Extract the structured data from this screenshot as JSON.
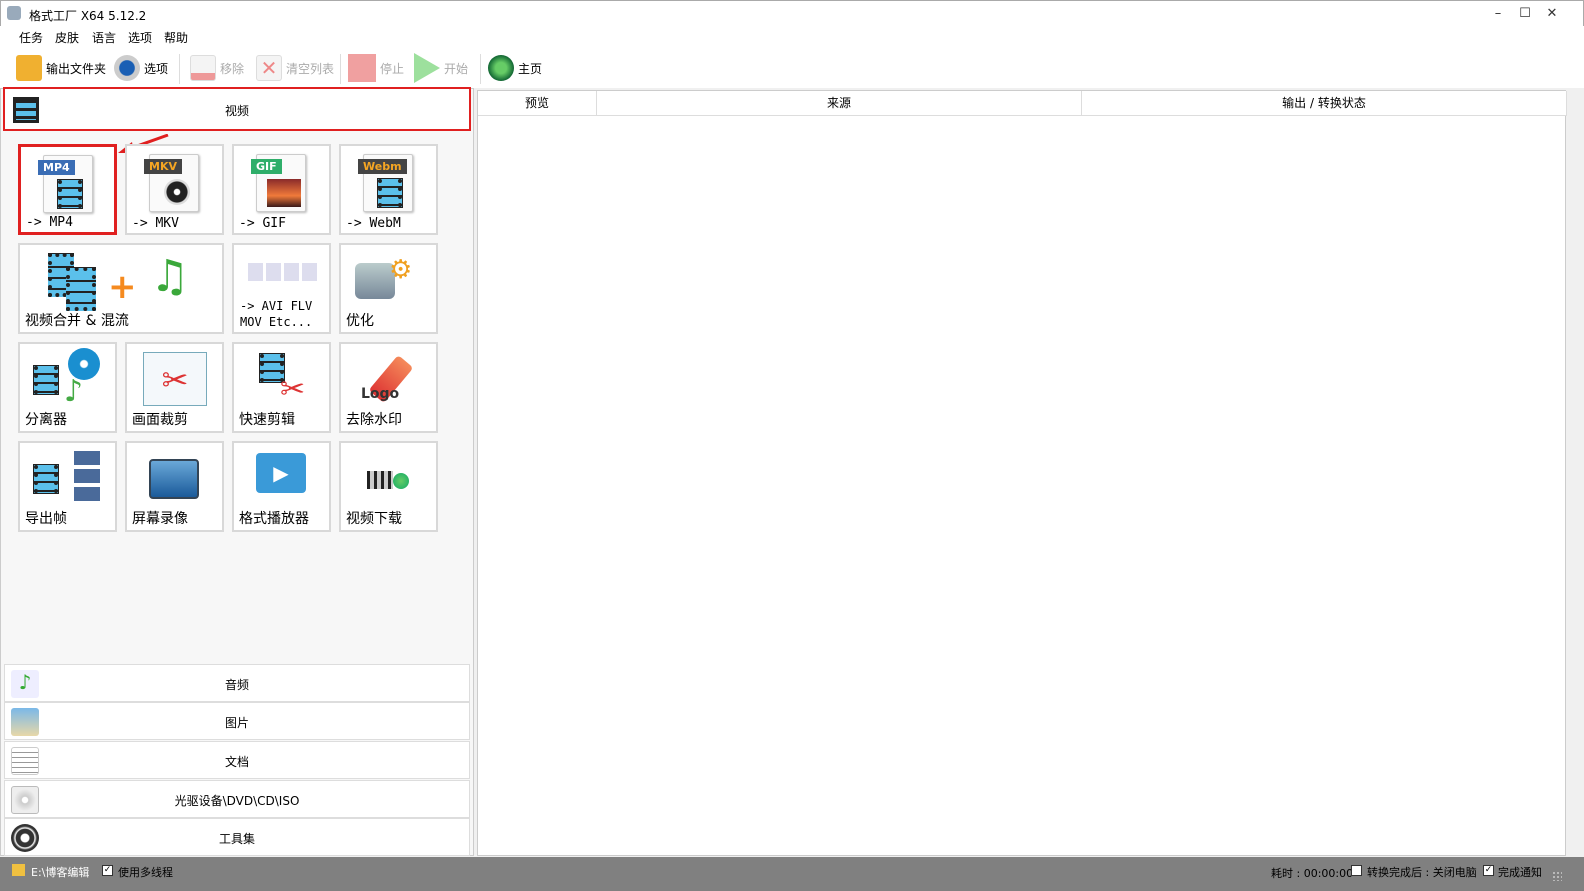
{
  "window": {
    "title": "格式工厂 X64 5.12.2",
    "minimize": "–",
    "maximize": "☐",
    "close": "✕"
  },
  "menu": [
    "任务",
    "皮肤",
    "语言",
    "选项",
    "帮助"
  ],
  "toolbar": {
    "output_folder": "输出文件夹",
    "options": "选项",
    "remove": "移除",
    "clear_list": "清空列表",
    "stop": "停止",
    "start": "开始",
    "home": "主页"
  },
  "video_section": {
    "label": "视频",
    "tiles": [
      {
        "badge": "MP4",
        "label": "-> MP4",
        "color": "#3a6db5"
      },
      {
        "badge": "MKV",
        "label": "-> MKV",
        "color": "#444444"
      },
      {
        "badge": "GIF",
        "label": "-> GIF",
        "color": "#2fae6a"
      },
      {
        "badge": "Webm",
        "label": "-> WebM",
        "color": "#444444"
      },
      {
        "label": "视频合并 & 混流"
      },
      {
        "label_line1": "-> AVI FLV",
        "label_line2": "MOV Etc..."
      },
      {
        "label": "优化"
      },
      {
        "label": "分离器"
      },
      {
        "label": "画面裁剪"
      },
      {
        "label": "快速剪辑"
      },
      {
        "label": "去除水印",
        "logo_text": "Logo"
      },
      {
        "label": "导出帧"
      },
      {
        "label": "屏幕录像"
      },
      {
        "label": "格式播放器"
      },
      {
        "label": "视频下载"
      }
    ]
  },
  "categories": [
    "音频",
    "图片",
    "文档",
    "光驱设备\\DVD\\CD\\ISO",
    "工具集"
  ],
  "table": {
    "columns": [
      "预览",
      "来源",
      "输出 / 转换状态"
    ]
  },
  "status": {
    "path": "E:\\博客编辑",
    "multithread": "使用多线程",
    "multithread_checked": true,
    "elapsed": "耗时 : 00:00:00",
    "shutdown": "转换完成后 : 关闭电脑",
    "shutdown_checked": false,
    "notify": "完成通知",
    "notify_checked": true
  }
}
